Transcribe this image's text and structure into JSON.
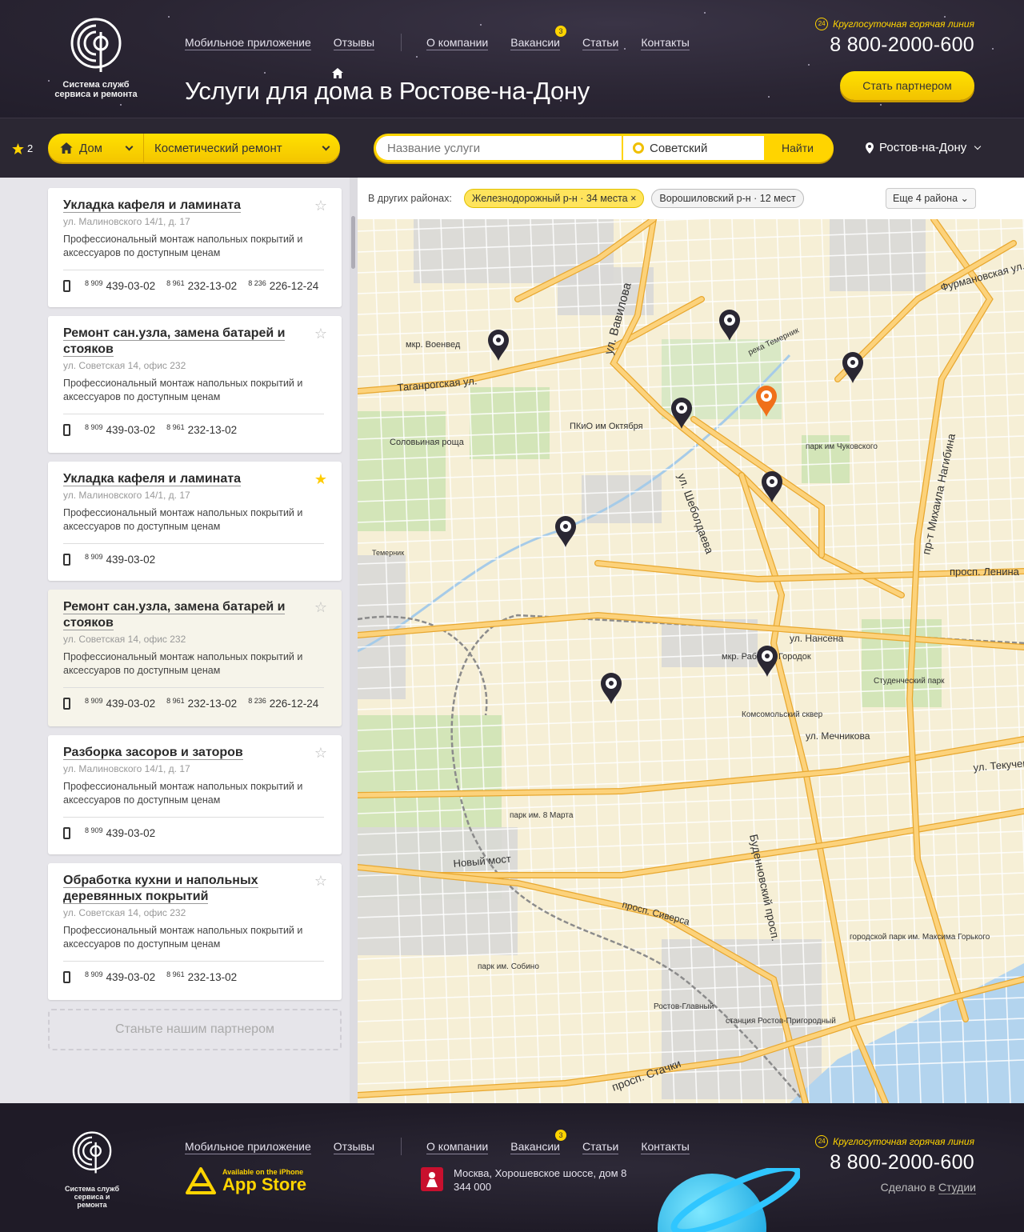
{
  "header": {
    "logo_text": "Система служб сервиса и ремонта",
    "nav": [
      {
        "label": "Мобильное приложение"
      },
      {
        "label": "Отзывы"
      },
      {
        "label": "О компании"
      },
      {
        "label": "Вакансии",
        "badge": "3"
      },
      {
        "label": "Статьи"
      },
      {
        "label": "Контакты"
      }
    ],
    "title": "Услуги для дома в Ростове-на-Дону",
    "hotline_label": "Круглосуточная горячая линия",
    "hotline_24": "24",
    "hotline_phone": "8 800-2000-600",
    "partner_button": "Стать партнером"
  },
  "filter": {
    "favorites_count": "2",
    "category": "Дом",
    "subcategory": "Косметический ремонт",
    "search_placeholder": "Название услуги",
    "district": "Советский",
    "search_button": "Найти",
    "city": "Ростов-на-Дону"
  },
  "listings": [
    {
      "title": "Укладка кафеля и ламината",
      "address": "ул. Малиновского 14/1, д. 17",
      "desc": "Профессиональный монтаж напольных покрытий и аксессуаров по доступным ценам",
      "starred": false,
      "phones": [
        {
          "code": "8 909",
          "num": "439-03-02"
        },
        {
          "code": "8 961",
          "num": "232-13-02"
        },
        {
          "code": "8 236",
          "num": "226-12-24"
        }
      ]
    },
    {
      "title": "Ремонт сан.узла, замена батарей и стояков",
      "address": "ул. Советская 14, офис 232",
      "desc": "Профессиональный монтаж напольных покрытий и аксессуаров по доступным ценам",
      "starred": false,
      "phones": [
        {
          "code": "8 909",
          "num": "439-03-02"
        },
        {
          "code": "8 961",
          "num": "232-13-02"
        }
      ]
    },
    {
      "title": "Укладка кафеля и ламината",
      "address": "ул. Малиновского 14/1, д. 17",
      "desc": "Профессиональный монтаж напольных покрытий и аксессуаров по доступным ценам",
      "starred": true,
      "phones": [
        {
          "code": "8 909",
          "num": "439-03-02"
        }
      ]
    },
    {
      "title": "Ремонт сан.узла, замена батарей и стояков",
      "address": "ул. Советская 14, офис 232",
      "desc": "Профессиональный монтаж напольных покрытий и аксессуаров по доступным ценам",
      "starred": false,
      "phones": [
        {
          "code": "8 909",
          "num": "439-03-02"
        },
        {
          "code": "8 961",
          "num": "232-13-02"
        },
        {
          "code": "8 236",
          "num": "226-12-24"
        }
      ]
    },
    {
      "title": "Разборка засоров и заторов",
      "address": "ул. Малиновского 14/1, д. 17",
      "desc": "Профессиональный монтаж напольных покрытий и аксессуаров по доступным ценам",
      "starred": false,
      "phones": [
        {
          "code": "8 909",
          "num": "439-03-02"
        }
      ]
    },
    {
      "title": "Обработка кухни и напольных деревянных покрытий",
      "address": "ул. Советская 14, офис 232",
      "desc": "Профессиональный монтаж напольных покрытий и аксессуаров по доступным ценам",
      "starred": false,
      "phones": [
        {
          "code": "8 909",
          "num": "439-03-02"
        },
        {
          "code": "8 961",
          "num": "232-13-02"
        }
      ]
    }
  ],
  "become_partner": "Станьте нашим партнером",
  "map": {
    "other_label": "В других районах:",
    "chips": [
      {
        "label": "Железнодорожный р-н · 34 места",
        "active": true,
        "close": "×"
      },
      {
        "label": "Ворошиловский р-н · 12 мест",
        "active": false
      }
    ],
    "more": "Еще 4 района",
    "labels": [
      {
        "text": "Таганрогская ул."
      },
      {
        "text": "ул. Вавилова"
      },
      {
        "text": "ул. Шеболдаева"
      },
      {
        "text": "пр-т Михаила Нагибина"
      },
      {
        "text": "просп. Ленина"
      },
      {
        "text": "ул. Нансена"
      },
      {
        "text": "ул. Мечникова"
      },
      {
        "text": "ул. Текучева"
      },
      {
        "text": "Буденновский просп."
      },
      {
        "text": "Новый мост"
      },
      {
        "text": "просп. Стачки"
      },
      {
        "text": "просп. Сиверса"
      },
      {
        "text": "Фурмановская ул."
      },
      {
        "text": "мкр. Военвед"
      },
      {
        "text": "Соловьиная роща"
      },
      {
        "text": "ПКиО им Октября"
      },
      {
        "text": "парк им Чуковского"
      },
      {
        "text": "Студенческий парк"
      },
      {
        "text": "Комсомольский сквер"
      },
      {
        "text": "мкр. Рабочий Городок"
      },
      {
        "text": "станция Ростов-Пригородный"
      },
      {
        "text": "Ростов-Главный"
      },
      {
        "text": "городской парк им. Максима Горького"
      },
      {
        "text": "парк им. Собино"
      },
      {
        "text": "парк им. 8 Марта"
      },
      {
        "text": "река Темерник"
      },
      {
        "text": "Темерник"
      }
    ]
  },
  "footer": {
    "logo_text": "Система служб сервиса и ремонта",
    "appstore_small": "Available on the iPhone",
    "appstore_big": "App Store",
    "address": "Москва, Хорошевское шоссе, дом 8 344 000",
    "credit_prefix": "Сделано в ",
    "credit_link": "Студии"
  }
}
